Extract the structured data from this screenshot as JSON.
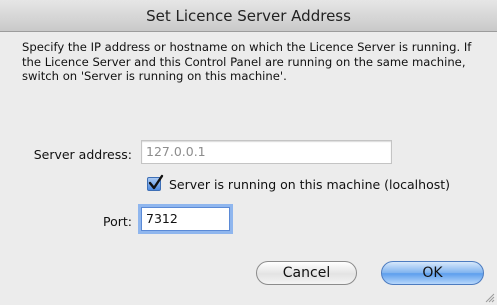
{
  "dialog": {
    "title": "Set Licence Server Address",
    "description": "Specify the IP address or hostname on which the Licence Server is running. If the Licence Server and this Control Panel are running on the same machine, switch on 'Server is running on this machine'."
  },
  "form": {
    "server_address_label": "Server address:",
    "server_address_value": "127.0.0.1",
    "localhost_checkbox_label": "Server is running on this machine (localhost)",
    "localhost_checked": true,
    "port_label": "Port:",
    "port_value": "7312"
  },
  "buttons": {
    "cancel_label": "Cancel",
    "ok_label": "OK"
  },
  "icons": {
    "checkmark": "checkmark-icon",
    "resize": "resize-grip-icon"
  }
}
